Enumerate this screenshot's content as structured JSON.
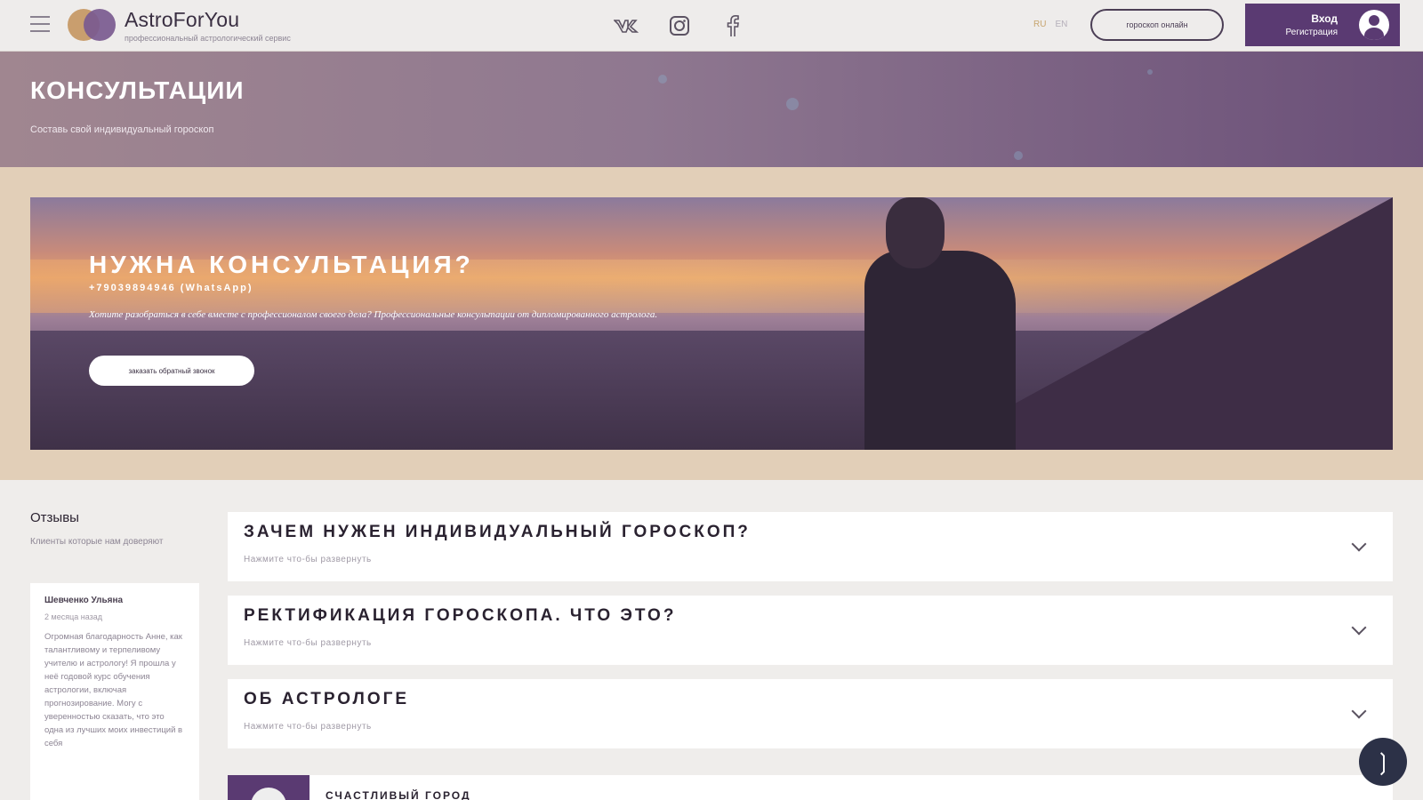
{
  "header": {
    "brand_name": "AstroForYou",
    "brand_tagline": "профессиональный астрологический сервис",
    "socials": [
      "vk-icon",
      "instagram-icon",
      "facebook-icon"
    ],
    "lang_ru": "RU",
    "lang_en": "EN",
    "online_button": "гороскоп онлайн",
    "login": "Вход",
    "register": "Регистрация"
  },
  "hero": {
    "title": "КОНСУЛЬТАЦИИ",
    "subtitle": "Составь свой индивидуальный гороскоп"
  },
  "banner": {
    "title": "НУЖНА КОНСУЛЬТАЦИЯ?",
    "phone": "+79039894946 (WhatsApp)",
    "description": "Хотите разобраться в себе вместе с профессионалом своего дела? Профессиональные консультации от дипломированного астролога.",
    "cta": "заказать обратный звонок"
  },
  "reviews": {
    "title": "Отзывы",
    "subtitle": "Клиенты которые нам доверяют",
    "card": {
      "author": "Шевченко Ульяна",
      "time": "2 месяца назад",
      "text": "Огромная благодарность Анне, как талантливому и терпеливому учителю и астрологу! Я прошла у неё годовой курс обучения астрологии, включая прогнозирование. Могу с уверенностью сказать, что это одна из лучших моих инвестиций в себя"
    }
  },
  "accordion": [
    {
      "title": "ЗАЧЕМ НУЖЕН ИНДИВИДУАЛЬНЫЙ ГОРОСКОП?",
      "hint": "Нажмите что-бы развернуть"
    },
    {
      "title": "РЕКТИФИКАЦИЯ ГОРОСКОПА. ЧТО ЭТО?",
      "hint": "Нажмите что-бы развернуть"
    },
    {
      "title": "ОБ АСТРОЛОГЕ",
      "hint": "Нажмите что-бы развернуть"
    }
  ],
  "bottom_card": {
    "title": "СЧАСТЛИВЫЙ ГОРОД"
  },
  "colors": {
    "accent_purple": "#5a3a72",
    "gold": "#c99e6e",
    "beige": "#e2cfb8"
  }
}
